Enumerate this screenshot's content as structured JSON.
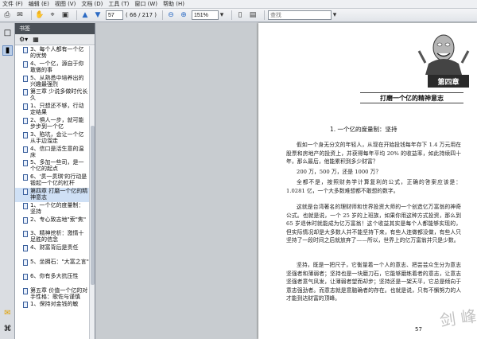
{
  "menu": [
    "文件 (F)",
    "编辑 (E)",
    "视图 (V)",
    "文档 (D)",
    "工具 (T)",
    "窗口 (W)",
    "帮助 (H)"
  ],
  "toolbar": {
    "page_number": "57",
    "page_total": "( 66 / 217 )",
    "zoom": "151%",
    "search_placeholder": "查找"
  },
  "panel": {
    "title": "书签",
    "bookmarks": [
      "3、每个人都有一个亿的优势",
      "4、一个亿，源自于你敢做的事",
      "5、从熟悉中培养出的兴趣最强烈",
      "第三章 少说多做时代长久",
      "1、只想还不够，行动定结果",
      "2、惧人一步，就可能步步到一个亿",
      "3、陷坑，会让一个亿从手边溜走",
      "4、信口是活生意的温床",
      "5、多加一些司，是一个亿的起点",
      "6、'贯一贯琪'的行动是锻起一个亿的杠杆",
      "第四章 打磨一个亿的精神意志",
      "1、一个亿的度量制：坚持",
      "2、专心致志地\"索\"焦\"",
      "3、精神挖析：激情十足胜的信念",
      "4、财富背后是责任",
      "5、坐拥石：\"大富之言\"",
      "6、你有多大抗压性",
      "第五章 价值一个亿的对手性格：歌佐与谨慎",
      "1、保持对金钱的敏"
    ],
    "selected_index": 10
  },
  "document": {
    "chapter_badge": "第四章",
    "chapter_title": "打磨一个亿的精神意志",
    "section_heading": "1. 一个亿的度量制：坚持",
    "paragraphs": [
      "假如一个身无分文的年轻人，从现在开始投钱每年存下 1.4 万元用在股票和房地产的投资上，并获得每年平均 20% 的收益率，如此持续四十年，那么最后，他能累积到多少财富？",
      "200 万，500 万，还是 1000 万？",
      "全都不是，按照财务学计算复利的公式，正确的答案应该是：1.0281 亿，一个大多数难想都不敢想的数字。",
      "这就是台湾著名的理财师和世界投资大师的一个创造亿万富翁的神奇公式。也就是说，一个 25 岁的上班族，如果你用这种方式投资，那么到 65 岁退休时就能成为亿万富翁！这个收益其实是每个人都能够实现的，但实际情况却是大多数人并不能坚持下来，有些人连做都没做，有些人只坚持了一段时间之后就放弃了——所以，世界上的亿万富翁并只是少数。",
      "坚持，既是一把尺子，它衡量着一个人的意志、把芸芸众生分为意志坚强者和薄弱者；坚持也是一块磨刀石，它能够磨练着者的意志，让意志坚强者意气风发，让薄弱者望而却步；坚持还是一架天平，它总是倾向于意志强劲者。而意志就是意脑确者的存在。也就是说，只有不懈努力的人才能到达财富的顶峰。"
    ],
    "page_number": "57",
    "watermark": "剑 峰"
  }
}
